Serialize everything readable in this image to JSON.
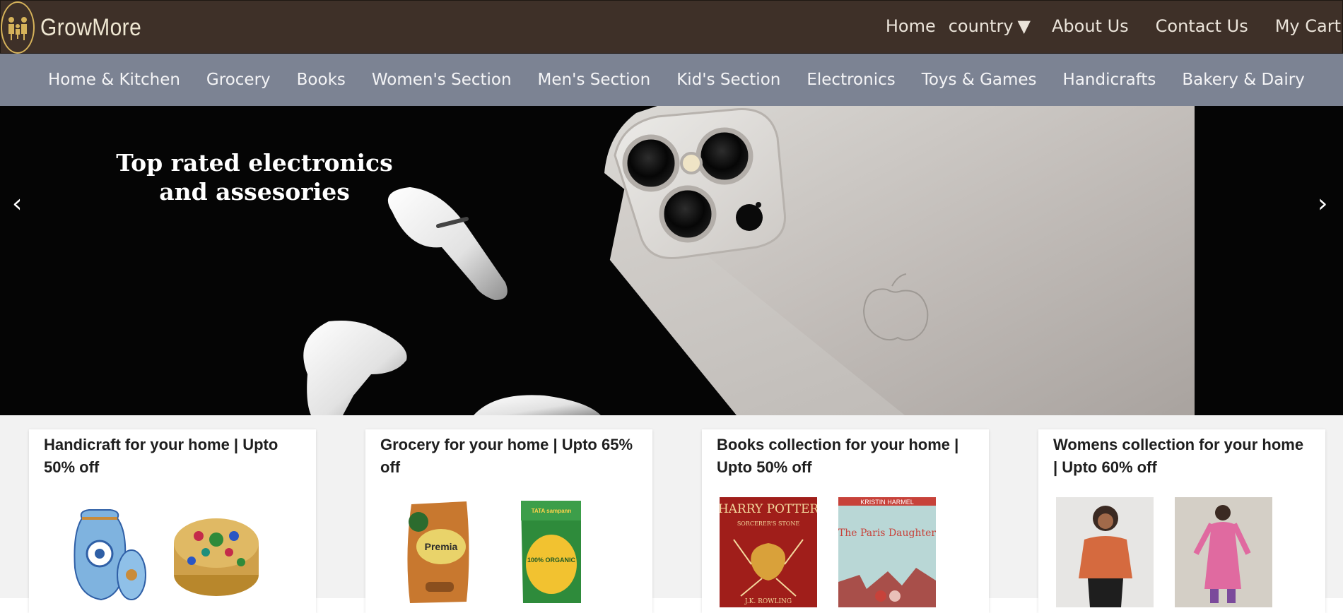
{
  "brand": {
    "name": "GrowMore"
  },
  "topnav": {
    "home": "Home",
    "country": "country",
    "about": "About Us",
    "contact": "Contact Us",
    "cart": "My Cart"
  },
  "categories": [
    "Home & Kitchen",
    "Grocery",
    "Books",
    "Women's Section",
    "Men's Section",
    "Kid's Section",
    "Electronics",
    "Toys & Games",
    "Handicrafts",
    "Bakery & Dairy"
  ],
  "hero": {
    "title_line1": "Top rated electronics",
    "title_line2": "and assesories",
    "prev": "‹",
    "next": "›"
  },
  "cards": [
    {
      "title": "Handicraft for your home | Upto 50% off"
    },
    {
      "title": "Grocery for your home | Upto 65% off"
    },
    {
      "title": "Books collection for your home | Upto 50% off"
    },
    {
      "title": "Womens collection for your home | Upto 60% off"
    }
  ],
  "book1": {
    "title": "HARRY POTTER",
    "subtitle": "SORCERER'S STONE",
    "author": "J.K. ROWLING"
  },
  "book2": {
    "author": "KRISTIN HARMEL",
    "title": "The Paris Daughter"
  },
  "grocery1": {
    "label": "Premia"
  },
  "grocery2": {
    "brand": "TATA sampann",
    "label": "100% ORGANIC"
  },
  "colors": {
    "header": "#3e3028",
    "catbar": "#7c8393",
    "accent": "#d6b35a"
  }
}
